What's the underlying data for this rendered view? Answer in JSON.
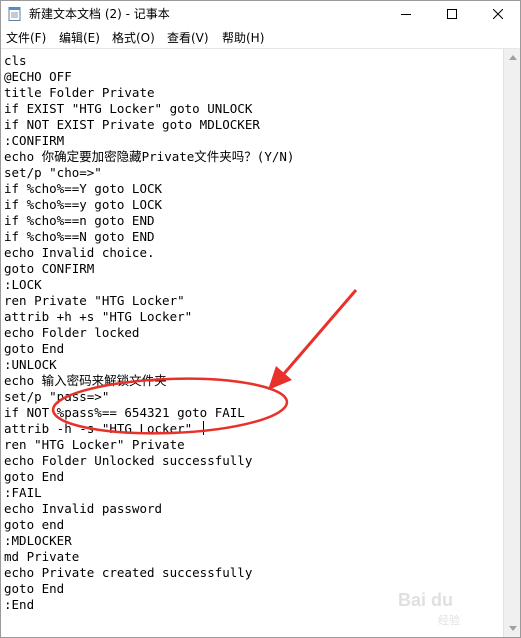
{
  "window": {
    "title": "新建文本文档 (2) - 记事本"
  },
  "menu": [
    {
      "label": "文件(F)"
    },
    {
      "label": "编辑(E)"
    },
    {
      "label": "格式(O)"
    },
    {
      "label": "查看(V)"
    },
    {
      "label": "帮助(H)"
    }
  ],
  "editor": {
    "lines": [
      "cls",
      "@ECHO OFF",
      "title Folder Private",
      "if EXIST \"HTG Locker\" goto UNLOCK",
      "if NOT EXIST Private goto MDLOCKER",
      ":CONFIRM",
      "echo 你确定要加密隐藏Private文件夹吗？(Y/N)",
      "set/p \"cho=>\"",
      "if %cho%==Y goto LOCK",
      "if %cho%==y goto LOCK",
      "if %cho%==n goto END",
      "if %cho%==N goto END",
      "echo Invalid choice.",
      "goto CONFIRM",
      ":LOCK",
      "ren Private \"HTG Locker\"",
      "attrib +h +s \"HTG Locker\"",
      "echo Folder locked",
      "goto End",
      ":UNLOCK",
      "echo 输入密码来解锁文件夹",
      "set/p \"pass=>\"",
      "if NOT %pass%== 654321 goto FAIL",
      "attrib -h -s \"HTG Locker\"",
      "ren \"HTG Locker\" Private",
      "echo Folder Unlocked successfully",
      "goto End",
      ":FAIL",
      "echo Invalid password",
      "goto end",
      ":MDLOCKER",
      "md Private",
      "echo Private created successfully",
      "goto End",
      ":End"
    ]
  },
  "annotation": {
    "color": "#e8312b"
  },
  "watermark": {
    "brand": "Bai du",
    "sub": "经验"
  },
  "icons": {
    "app": "notepad-icon",
    "minimize": "minimize-icon",
    "maximize": "maximize-icon",
    "close": "close-icon"
  }
}
